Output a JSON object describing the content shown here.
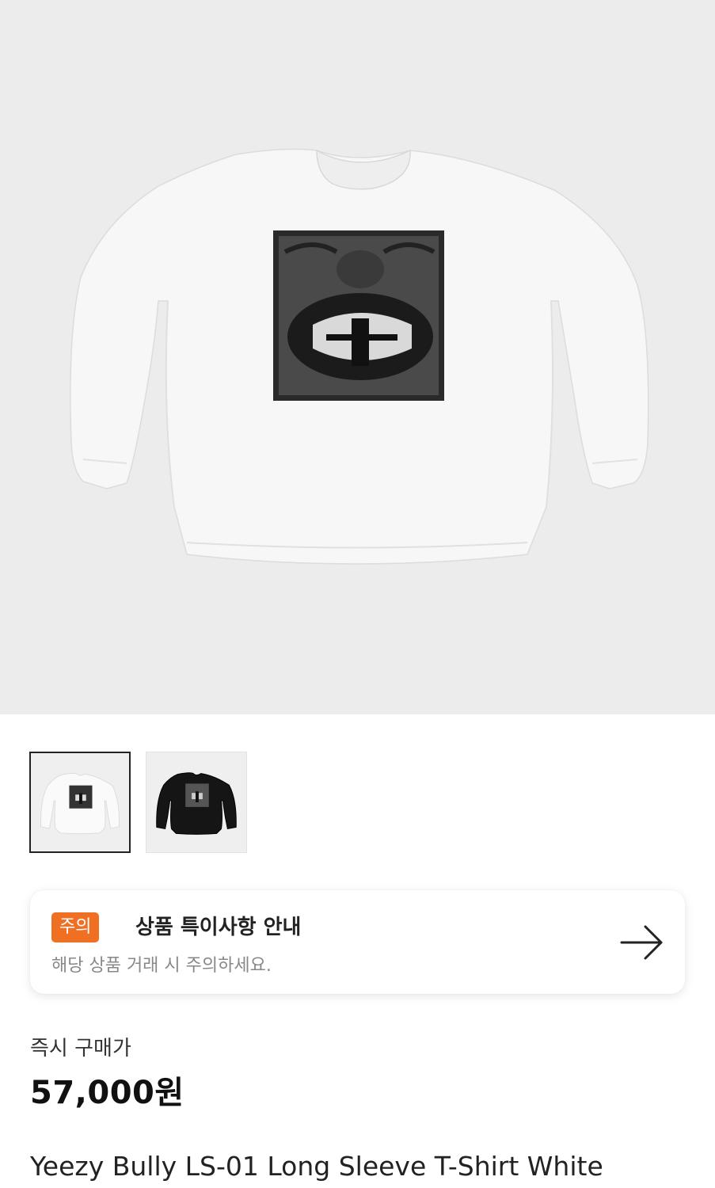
{
  "product": {
    "main_image_name": "shirt-white-main",
    "thumbnails": [
      {
        "name": "thumbnail-white",
        "color": "#f6f6f6",
        "selected": true
      },
      {
        "name": "thumbnail-black",
        "color": "#151515",
        "selected": false
      }
    ]
  },
  "notice": {
    "badge": "주의",
    "title": "상품 특이사항 안내",
    "subtitle": "해당 상품 거래 시 주의하세요.",
    "arrow_icon": "arrow-right-icon",
    "badge_color": "#ef6f23"
  },
  "purchase": {
    "label": "즉시 구매가",
    "price": "57,000원"
  },
  "title": "Yeezy Bully LS-01 Long Sleeve T-Shirt White"
}
